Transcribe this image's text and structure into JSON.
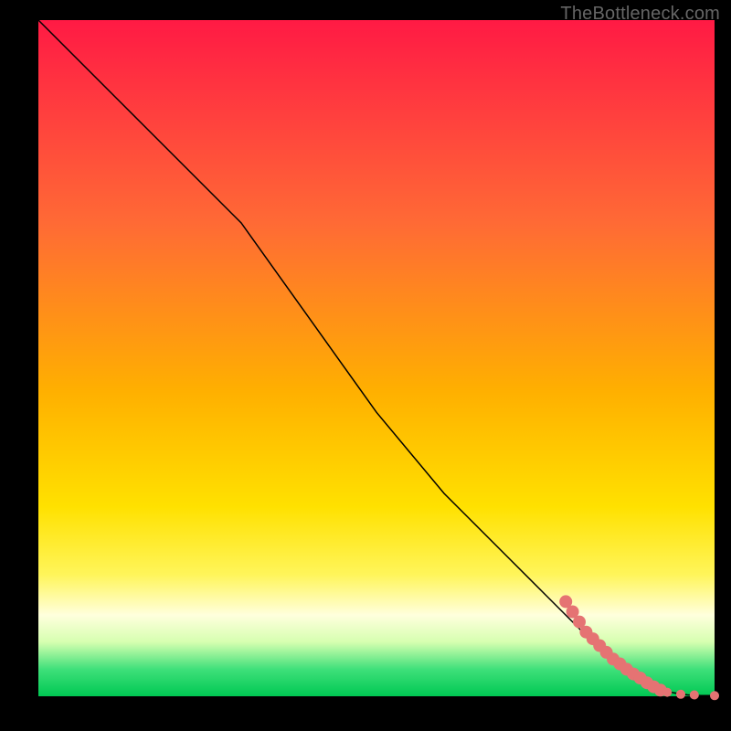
{
  "watermark": "TheBottleneck.com",
  "chart_data": {
    "type": "line",
    "title": "",
    "xlabel": "",
    "ylabel": "",
    "xlim": [
      0,
      100
    ],
    "ylim": [
      0,
      100
    ],
    "grid": false,
    "legend": false,
    "line": {
      "color": "#000000",
      "width": 1.5,
      "x": [
        0,
        5,
        10,
        15,
        20,
        25,
        30,
        35,
        40,
        45,
        50,
        55,
        60,
        65,
        70,
        75,
        80,
        83,
        85,
        88,
        90,
        92,
        94,
        96,
        98,
        100
      ],
      "y": [
        100,
        95,
        90,
        85,
        80,
        75,
        70,
        63,
        56,
        49,
        42,
        36,
        30,
        25,
        20,
        15,
        10,
        7,
        5,
        3,
        2,
        1,
        0.5,
        0.2,
        0.1,
        0.1
      ]
    },
    "beads": {
      "color": "#e57373",
      "radius_major": 7,
      "radius_minor": 5,
      "points": [
        {
          "x": 78,
          "y": 14
        },
        {
          "x": 79,
          "y": 12.5
        },
        {
          "x": 80,
          "y": 11
        },
        {
          "x": 81,
          "y": 9.5
        },
        {
          "x": 82,
          "y": 8.5
        },
        {
          "x": 83,
          "y": 7.5
        },
        {
          "x": 84,
          "y": 6.5
        },
        {
          "x": 85,
          "y": 5.5
        },
        {
          "x": 86,
          "y": 4.8
        },
        {
          "x": 87,
          "y": 4.0
        },
        {
          "x": 88,
          "y": 3.3
        },
        {
          "x": 89,
          "y": 2.7
        },
        {
          "x": 90,
          "y": 2.0
        },
        {
          "x": 91,
          "y": 1.4
        },
        {
          "x": 92,
          "y": 0.9
        },
        {
          "x": 93,
          "y": 0.6,
          "minor": true
        },
        {
          "x": 95,
          "y": 0.3,
          "minor": true
        },
        {
          "x": 97,
          "y": 0.2,
          "minor": true
        },
        {
          "x": 100,
          "y": 0.1,
          "minor": true
        }
      ]
    }
  }
}
